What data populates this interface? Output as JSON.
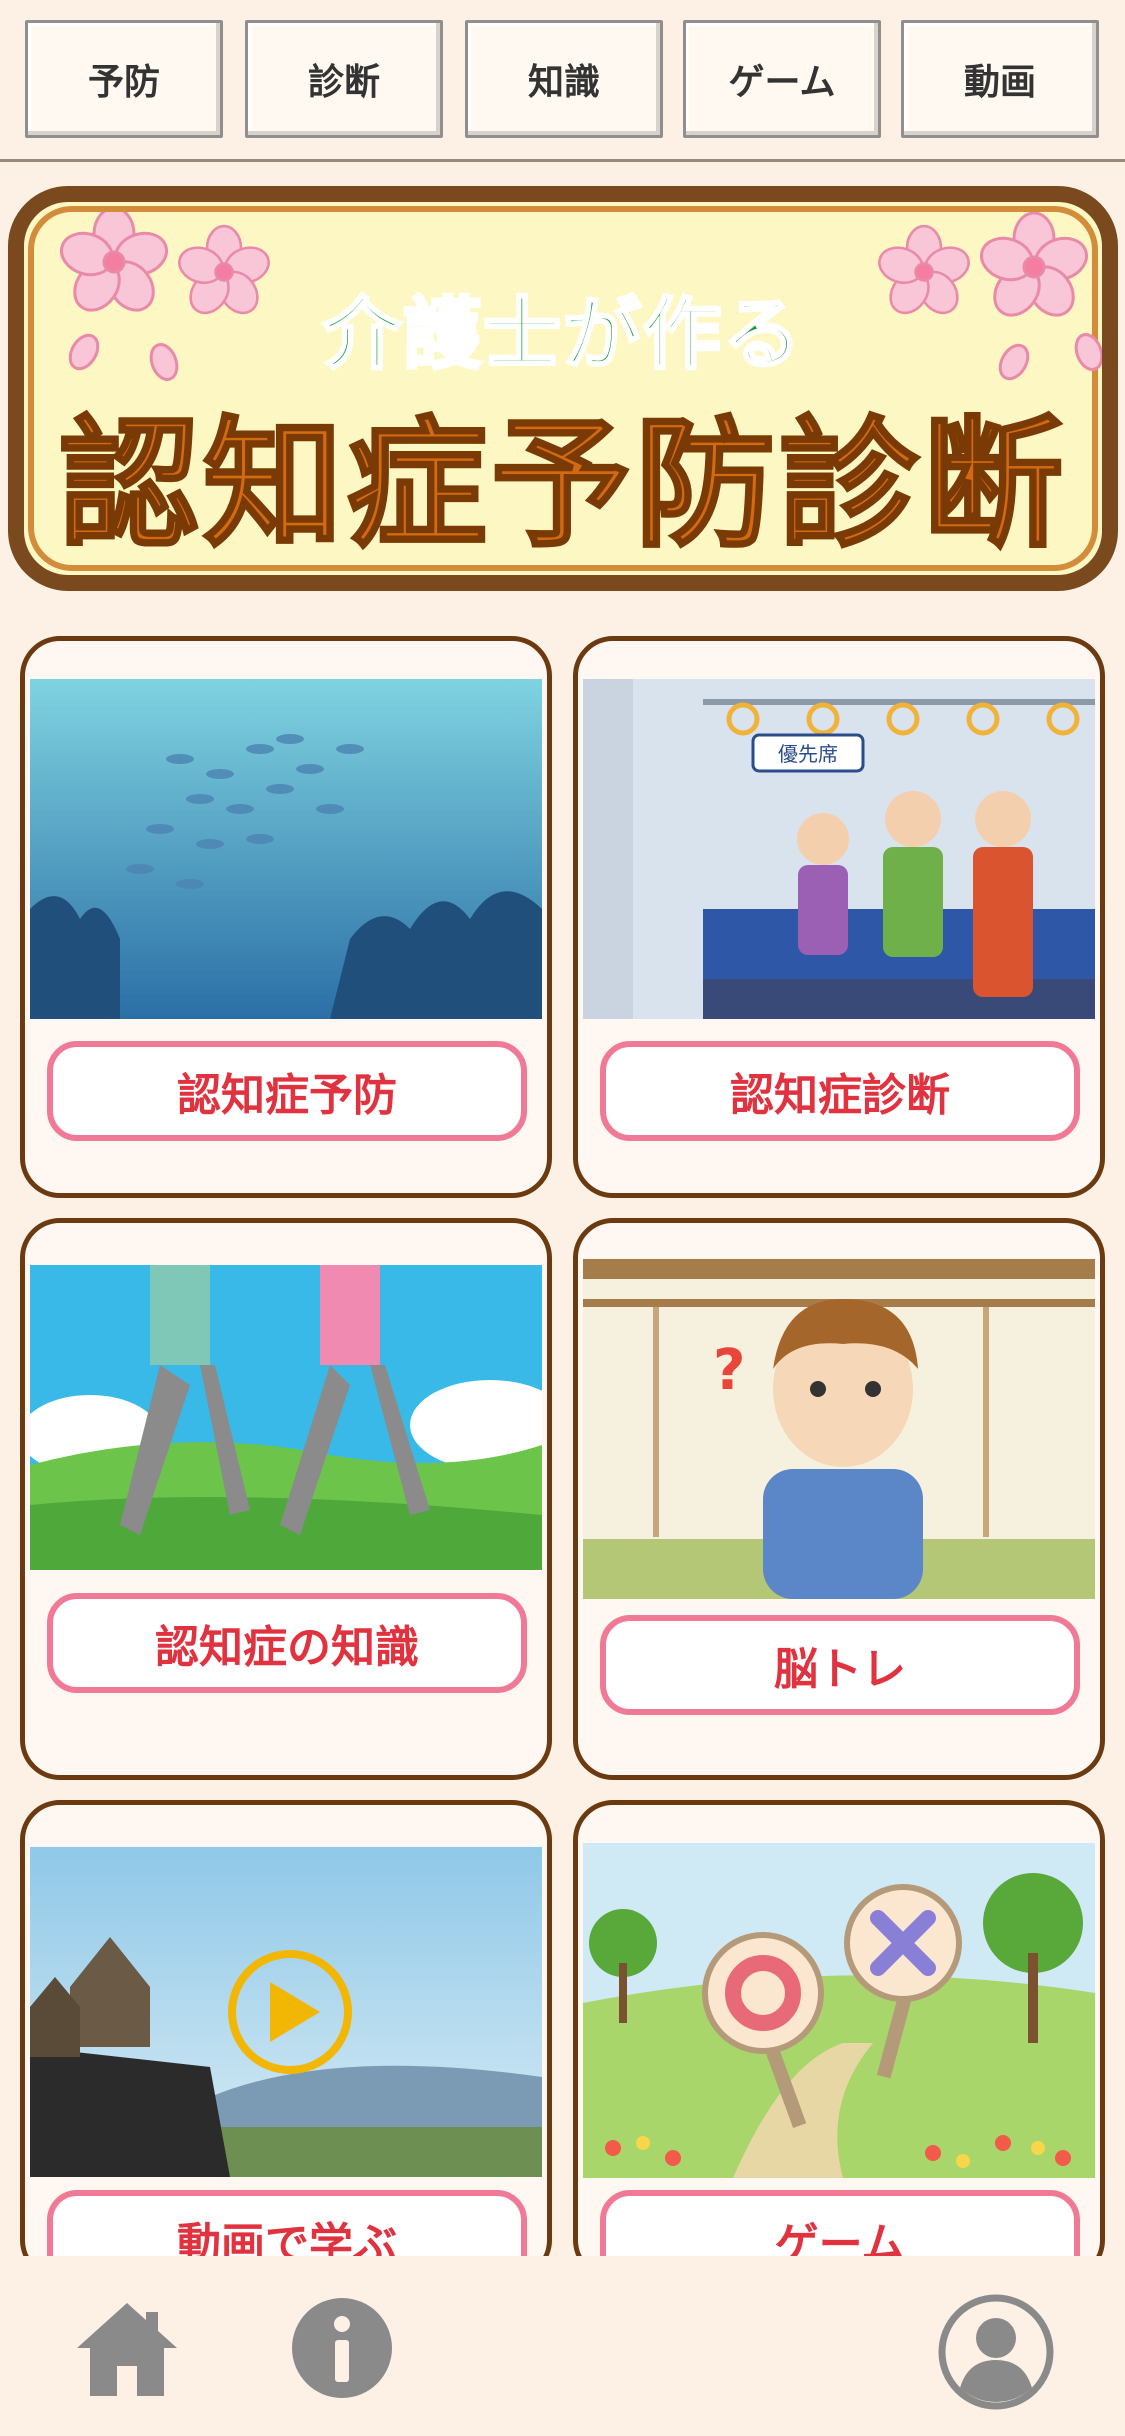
{
  "tabs": [
    "予防",
    "診断",
    "知識",
    "ゲーム",
    "動画"
  ],
  "banner": {
    "subtitle": "介護士が作る",
    "title": "認知症予防診断"
  },
  "cards": [
    {
      "label": "認知症予防",
      "image": "fish-school-underwater-illustration"
    },
    {
      "label": "認知症診断",
      "image": "train-priority-seat-elderly-illustration",
      "sign": "優先席"
    },
    {
      "label": "認知症の知識",
      "image": "walking-couple-park-illustration"
    },
    {
      "label": "脳トレ",
      "image": "thinking-man-japanese-room-illustration"
    },
    {
      "label": "動画で学ぶ",
      "image": "house-video-play-illustration"
    },
    {
      "label": "ゲーム",
      "image": "circle-cross-signs-park-illustration"
    }
  ],
  "bottom_bar": {
    "icons": [
      "home-icon",
      "info-icon",
      "account-icon"
    ]
  },
  "colors": {
    "background": "#fdf1e6",
    "banner_border": "#7a4a1e",
    "title_orange": "#d46a10",
    "subtitle_green": "#1d9d3a",
    "button_border": "#f07a96",
    "button_text": "#e0333f"
  }
}
